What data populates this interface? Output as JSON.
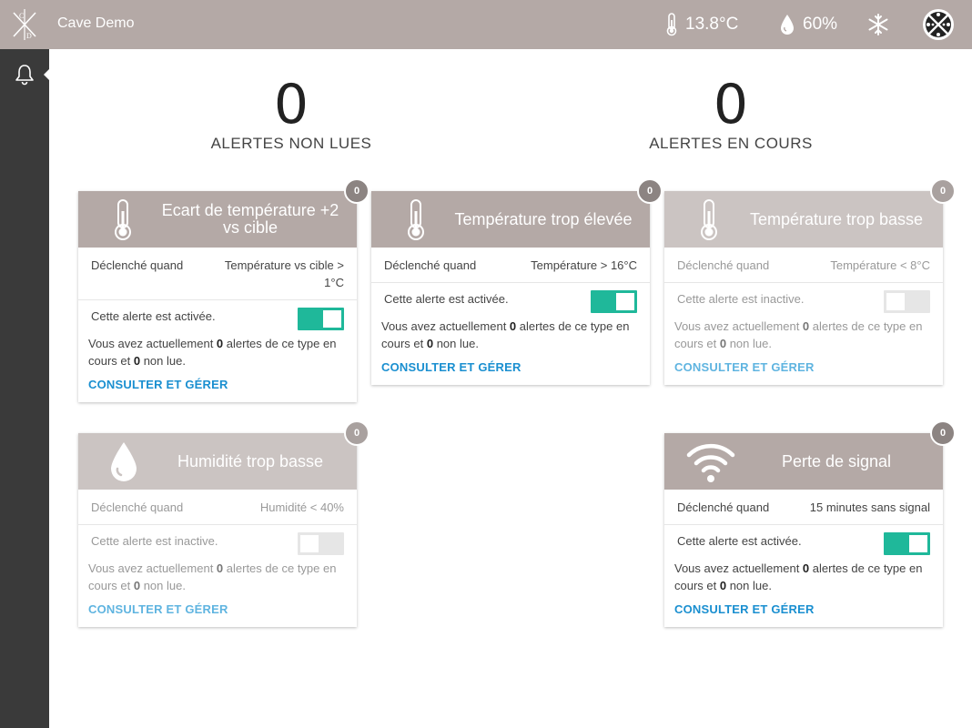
{
  "app": {
    "title": "Cave Demo"
  },
  "status": {
    "temperature": "13.8°C",
    "humidity": "60%"
  },
  "counters": {
    "unread": {
      "value": "0",
      "label": "ALERTES NON LUES"
    },
    "current": {
      "value": "0",
      "label": "ALERTES EN COURS"
    }
  },
  "cards": [
    {
      "title": "Ecart de température +2 vs cible",
      "badge": "0",
      "trigger_key": "Déclenché quand",
      "trigger_val": "Température vs cible > 1°C",
      "status_text": "Cette alerte est activée.",
      "toggle": "on",
      "info_pre": "Vous avez actuellement ",
      "info_count": "0",
      "info_mid": " alertes de ce type en cours et ",
      "info_unread": "0",
      "info_post": " non lue.",
      "link": "CONSULTER ET GÉRER",
      "icon": "thermometer-icon"
    },
    {
      "title": "Température trop élevée",
      "badge": "0",
      "trigger_key": "Déclenché quand",
      "trigger_val": "Température > 16°C",
      "status_text": "Cette alerte est activée.",
      "toggle": "on",
      "info_pre": "Vous avez actuellement ",
      "info_count": "0",
      "info_mid": " alertes de ce type en cours et ",
      "info_unread": "0",
      "info_post": " non lue.",
      "link": "CONSULTER ET GÉRER",
      "icon": "thermometer-icon"
    },
    {
      "title": "Température trop basse",
      "badge": "0",
      "trigger_key": "Déclenché quand",
      "trigger_val": "Température < 8°C",
      "status_text": "Cette alerte est inactive.",
      "toggle": "off",
      "info_pre": "Vous avez actuellement ",
      "info_count": "0",
      "info_mid": " alertes de ce type en cours et ",
      "info_unread": "0",
      "info_post": " non lue.",
      "link": "CONSULTER ET GÉRER",
      "icon": "thermometer-icon"
    },
    {
      "title": "Humidité trop basse",
      "badge": "0",
      "trigger_key": "Déclenché quand",
      "trigger_val": "Humidité < 40%",
      "status_text": "Cette alerte est inactive.",
      "toggle": "off",
      "info_pre": "Vous avez actuellement ",
      "info_count": "0",
      "info_mid": " alertes de ce type en cours et ",
      "info_unread": "0",
      "info_post": " non lue.",
      "link": "CONSULTER ET GÉRER",
      "icon": "water-drop-icon"
    },
    {
      "title": "Perte de signal",
      "badge": "0",
      "trigger_key": "Déclenché quand",
      "trigger_val": "15 minutes sans signal",
      "status_text": "Cette alerte est activée.",
      "toggle": "on",
      "info_pre": "Vous avez actuellement ",
      "info_count": "0",
      "info_mid": " alertes de ce type en cours et ",
      "info_unread": "0",
      "info_post": " non lue.",
      "link": "CONSULTER ET GÉRER",
      "icon": "wifi-icon"
    }
  ],
  "colors": {
    "topbar": "#b4a9a6",
    "sidebar": "#3a3a3a",
    "toggle_on": "#1fb89a",
    "link": "#1a8fd0"
  }
}
